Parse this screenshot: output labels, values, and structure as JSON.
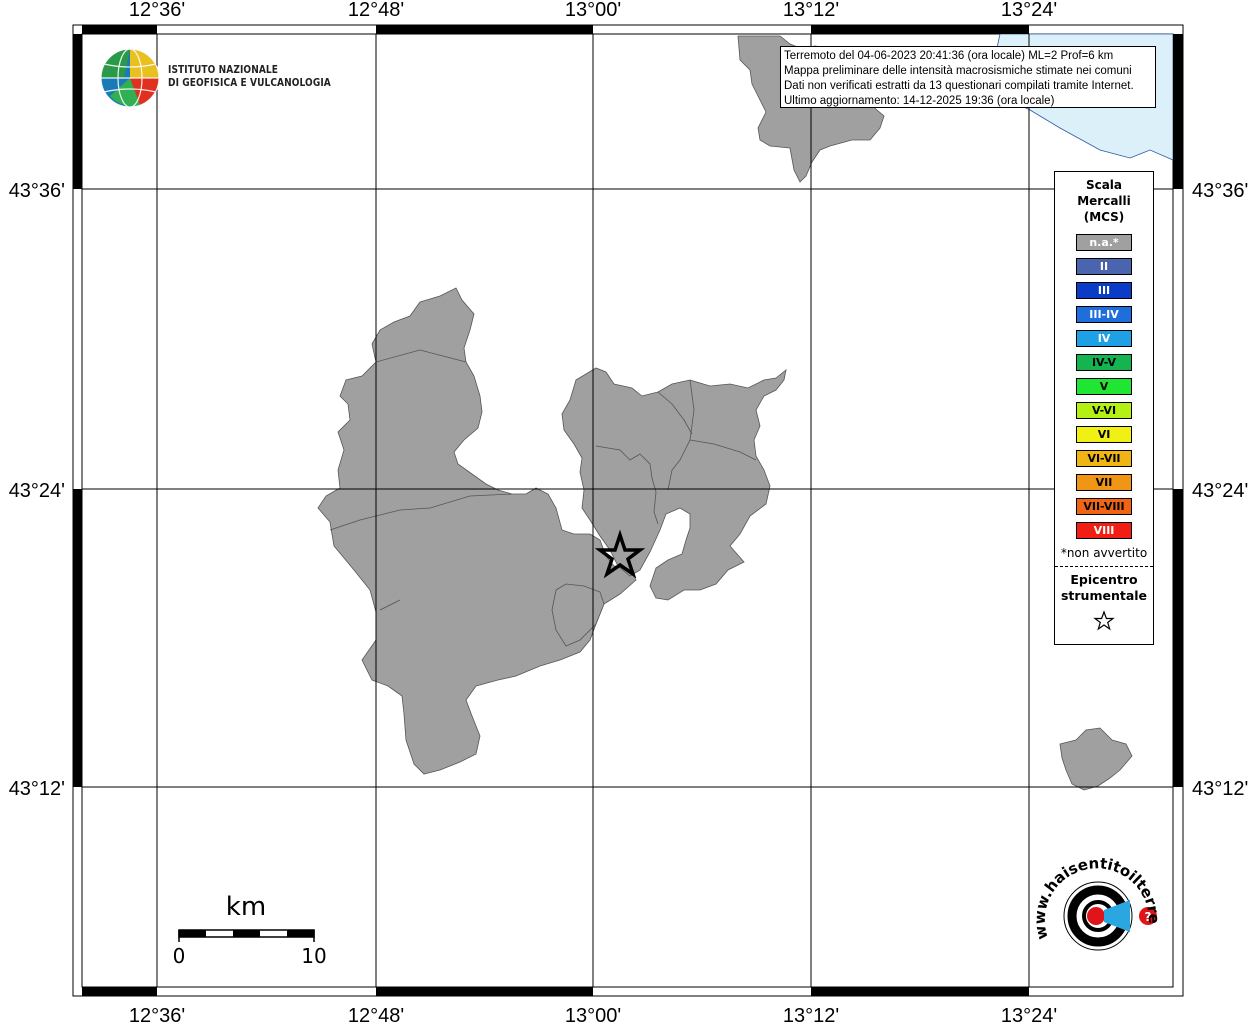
{
  "axes": {
    "longitude_labels": [
      "12°36'",
      "12°48'",
      "13°00'",
      "13°12'",
      "13°24'"
    ],
    "latitude_labels": [
      "43°36'",
      "43°24'",
      "43°12'"
    ]
  },
  "logo": {
    "line1": "ISTITUTO NAZIONALE",
    "line2": "DI GEOFISICA E VULCANOLOGIA"
  },
  "info": {
    "line1": "Terremoto del 04-06-2023 20:41:36 (ora locale) ML=2 Prof=6 km",
    "line2": "Mappa preliminare delle intensità macrosismiche stimate nei comuni",
    "line3": "Dati non verificati estratti da 13 questionari compilati tramite Internet.",
    "line4": "Ultimo aggiornamento: 14-12-2025 19:36 (ora locale)"
  },
  "legend": {
    "title1": "Scala",
    "title2": "Mercalli",
    "title3": "(MCS)",
    "levels": [
      {
        "label": "n.a.*",
        "color": "#a0a0a0",
        "text_color": "#ffffff"
      },
      {
        "label": "II",
        "color": "#4a64b0",
        "text_color": "#ffffff"
      },
      {
        "label": "III",
        "color": "#0a3cc8",
        "text_color": "#ffffff"
      },
      {
        "label": "III-IV",
        "color": "#1e6edc",
        "text_color": "#ffffff"
      },
      {
        "label": "IV",
        "color": "#1ea0e6",
        "text_color": "#ffffff"
      },
      {
        "label": "IV-V",
        "color": "#14b450",
        "text_color": "#000000"
      },
      {
        "label": "V",
        "color": "#1ee632",
        "text_color": "#000000"
      },
      {
        "label": "V-VI",
        "color": "#b4f014",
        "text_color": "#000000"
      },
      {
        "label": "VI",
        "color": "#f0f014",
        "text_color": "#000000"
      },
      {
        "label": "VI-VII",
        "color": "#f0b414",
        "text_color": "#000000"
      },
      {
        "label": "VII",
        "color": "#f09614",
        "text_color": "#000000"
      },
      {
        "label": "VII-VIII",
        "color": "#f06414",
        "text_color": "#000000"
      },
      {
        "label": "VIII",
        "color": "#f01e14",
        "text_color": "#ffffff"
      }
    ],
    "note": "*non avvertito",
    "epicentre1": "Epicentro",
    "epicentre2": "strumentale"
  },
  "scalebar": {
    "unit": "km",
    "start": "0",
    "end": "10"
  },
  "colors": {
    "land": "#a0a0a0",
    "sea": "#dcf0fa",
    "frame": "#000000"
  },
  "brand": {
    "text": "www.haisentitoilterremoto.it"
  }
}
